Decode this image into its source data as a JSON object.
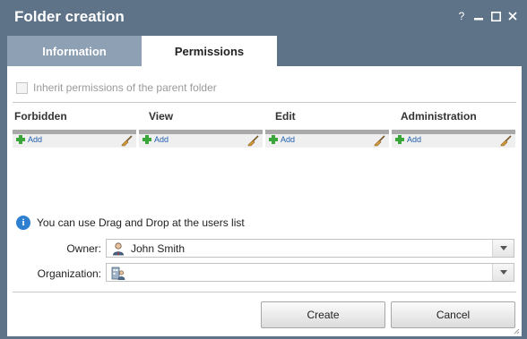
{
  "window": {
    "title": "Folder creation"
  },
  "title_controls": {
    "help": "?",
    "minimize": "–",
    "maximize": "□",
    "close": "✕"
  },
  "tabs": [
    {
      "label": "Information",
      "active": false
    },
    {
      "label": "Permissions",
      "active": true
    }
  ],
  "inherit": {
    "label": "Inherit permissions of the parent folder",
    "checked": false,
    "enabled": false
  },
  "columns": [
    {
      "header": "Forbidden",
      "add_label": "Add"
    },
    {
      "header": "View",
      "add_label": "Add"
    },
    {
      "header": "Edit",
      "add_label": "Add"
    },
    {
      "header": "Administration",
      "add_label": "Add"
    }
  ],
  "hint": {
    "text": "You can use Drag and Drop at the users list"
  },
  "owner": {
    "label": "Owner:",
    "value": "John Smith"
  },
  "organization": {
    "label": "Organization:",
    "value": ""
  },
  "buttons": {
    "create": "Create",
    "cancel": "Cancel"
  },
  "colors": {
    "window_frame": "#5f7388",
    "inactive_tab": "#8ea0b4",
    "add_plus": "#3aa63a",
    "add_link": "#1f5fb0",
    "info_icon": "#2f7fd0"
  }
}
